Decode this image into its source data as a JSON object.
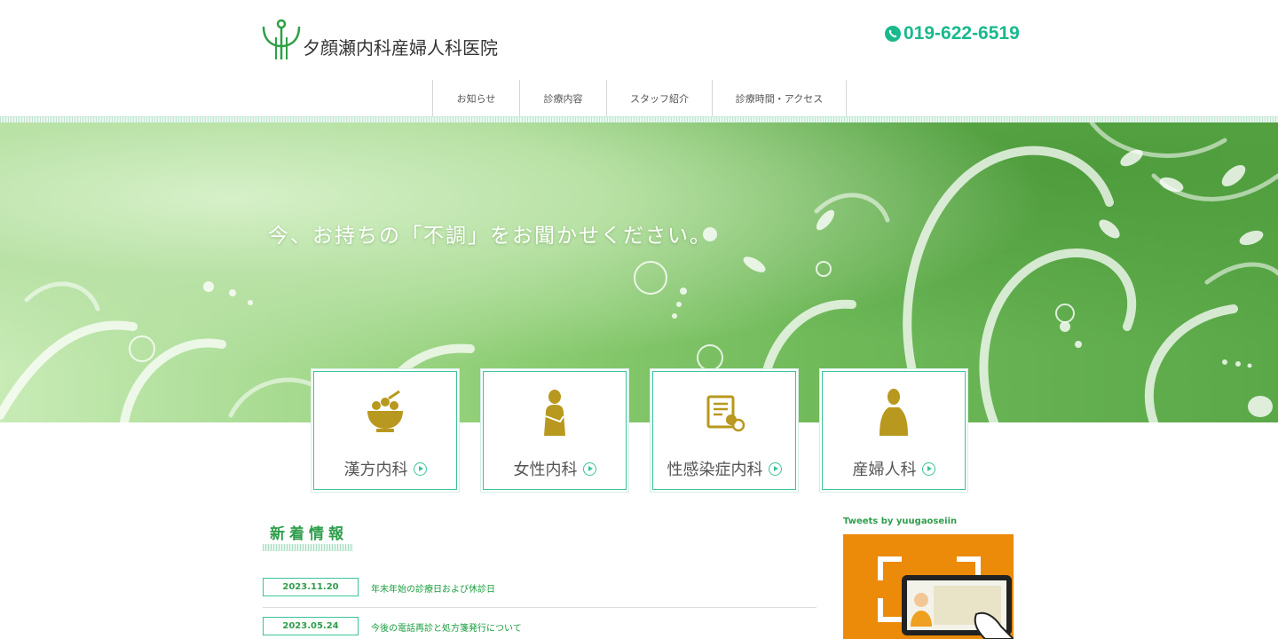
{
  "header": {
    "clinic_name": "夕顔瀬内科産婦人科医院",
    "phone": "019-622-6519"
  },
  "nav": {
    "items": [
      {
        "label": "お知らせ"
      },
      {
        "label": "診療内容"
      },
      {
        "label": "スタッフ紹介"
      },
      {
        "label": "診療時間・アクセス"
      }
    ]
  },
  "hero": {
    "tagline": "今、お持ちの「不調」をお聞かせください。"
  },
  "services": [
    {
      "label": "漢方内科",
      "icon": "herb-mortar-icon"
    },
    {
      "label": "女性内科",
      "icon": "woman-icon"
    },
    {
      "label": "性感染症内科",
      "icon": "document-pills-icon"
    },
    {
      "label": "産婦人科",
      "icon": "woman-silhouette-icon"
    }
  ],
  "news": {
    "heading": "新着情報",
    "items": [
      {
        "date": "2023.11.20",
        "title": "年末年始の診療日および休診日"
      },
      {
        "date": "2023.05.24",
        "title": "今後の電話再診と処方箋発行について"
      }
    ]
  },
  "twitter": {
    "title": "Tweets by yuugaoseiin"
  },
  "colors": {
    "accent": "#3cc39a",
    "phone": "#19b98d",
    "icon_gold": "#b8981e",
    "heading_green": "#2f9e4c"
  }
}
